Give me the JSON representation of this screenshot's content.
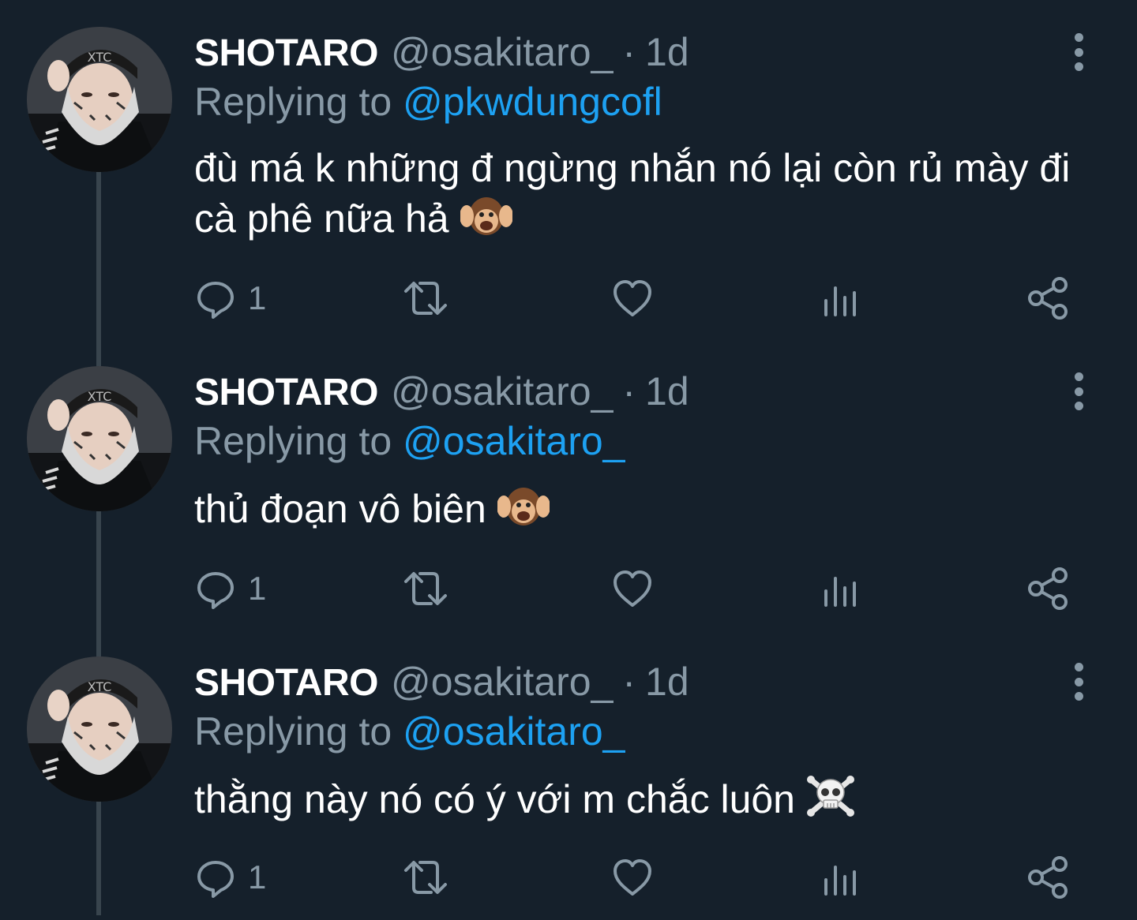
{
  "colors": {
    "background": "#15202b",
    "muted": "#8899a6",
    "accent": "#1da1f2",
    "thread_line": "#38444d"
  },
  "tweets": [
    {
      "display_name": "SHOTARO",
      "handle": "@osakitaro_",
      "separator": "·",
      "time": "1d",
      "reply_prefix": "Replying to ",
      "reply_to": "@pkwdungcofl",
      "text": "đù má k những đ ngừng nhắn nó lại còn rủ mày đi cà phê nữa hả",
      "emoji": "hear-no-evil-monkey",
      "reply_count": "1"
    },
    {
      "display_name": "SHOTARO",
      "handle": "@osakitaro_",
      "separator": "·",
      "time": "1d",
      "reply_prefix": "Replying to ",
      "reply_to": "@osakitaro_",
      "text": "thủ đoạn vô biên",
      "emoji": "hear-no-evil-monkey",
      "reply_count": "1"
    },
    {
      "display_name": "SHOTARO",
      "handle": "@osakitaro_",
      "separator": "·",
      "time": "1d",
      "reply_prefix": "Replying to ",
      "reply_to": "@osakitaro_",
      "text": "thằng này nó có ý với m chắc luôn",
      "emoji": "skull-and-crossbones",
      "reply_count": "1"
    }
  ],
  "icons": {
    "reply": "reply-icon",
    "retweet": "retweet-icon",
    "like": "heart-icon",
    "analytics": "analytics-icon",
    "share": "share-icon",
    "more": "more-vertical-icon"
  }
}
